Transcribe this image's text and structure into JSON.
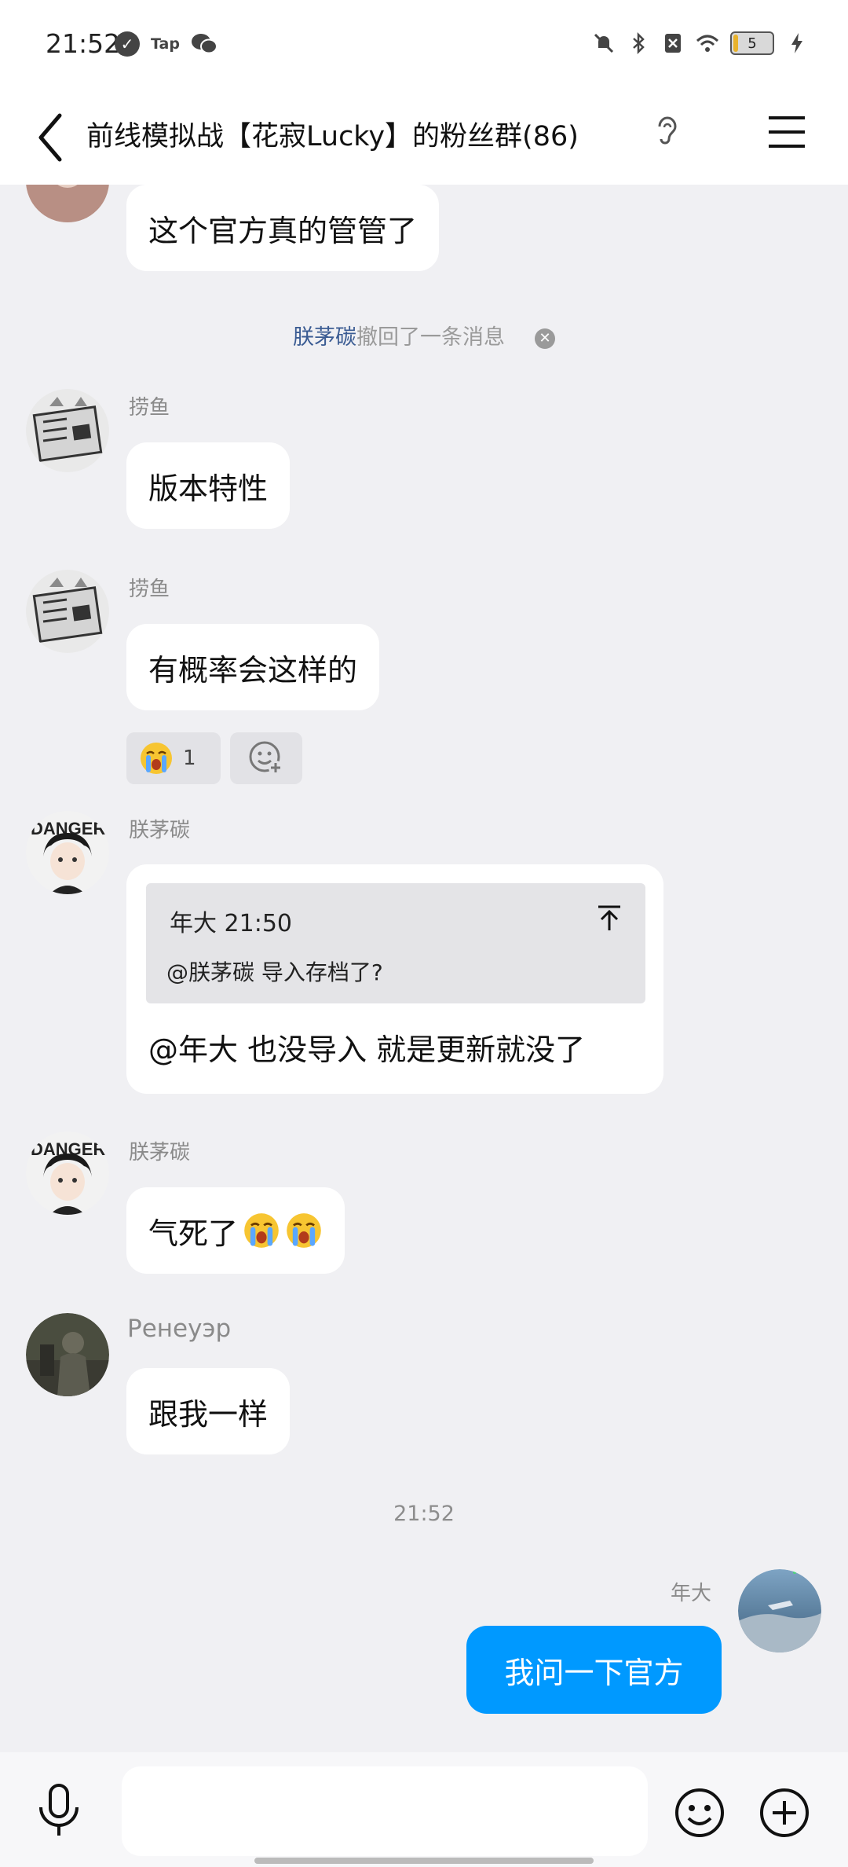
{
  "status_bar": {
    "time": "21:52",
    "tap_label": "Tap",
    "battery_level": "5"
  },
  "header": {
    "title": "前线模拟战【花寂Lucky】的粉丝群(86)"
  },
  "messages": {
    "m1": {
      "text": "这个官方真的管管了"
    },
    "recall": {
      "who": "朕茅碳",
      "rest": "撤回了一条消息"
    },
    "m2": {
      "sender": "捞鱼",
      "text": "版本特性"
    },
    "m3": {
      "sender": "捞鱼",
      "text": "有概率会这样的",
      "reaction_count": "1"
    },
    "m4": {
      "sender": "朕茅碳",
      "quote_meta": "年大 21:50",
      "quote_text": "@朕茅碳 导入存档了?",
      "text": "@年大 也没导入 就是更新就没了"
    },
    "m5": {
      "sender": "朕茅碳",
      "text": "气死了"
    },
    "m6": {
      "sender": "Ренеуэр",
      "text": "跟我一样"
    },
    "time_divider": "21:52",
    "m7": {
      "sender": "年大",
      "text": "我问一下官方"
    }
  },
  "input": {
    "placeholder": ""
  },
  "colors": {
    "background": "#f0f0f3",
    "bubble_self": "#0099ff",
    "bubble_other": "#ffffff",
    "recall_name": "#3b5c93"
  },
  "icons": [
    "back-icon",
    "ear-icon",
    "menu-icon",
    "close-icon",
    "crying-emoji-icon",
    "add-reaction-icon",
    "quote-top-icon",
    "mic-icon",
    "emoji-icon",
    "plus-icon"
  ]
}
